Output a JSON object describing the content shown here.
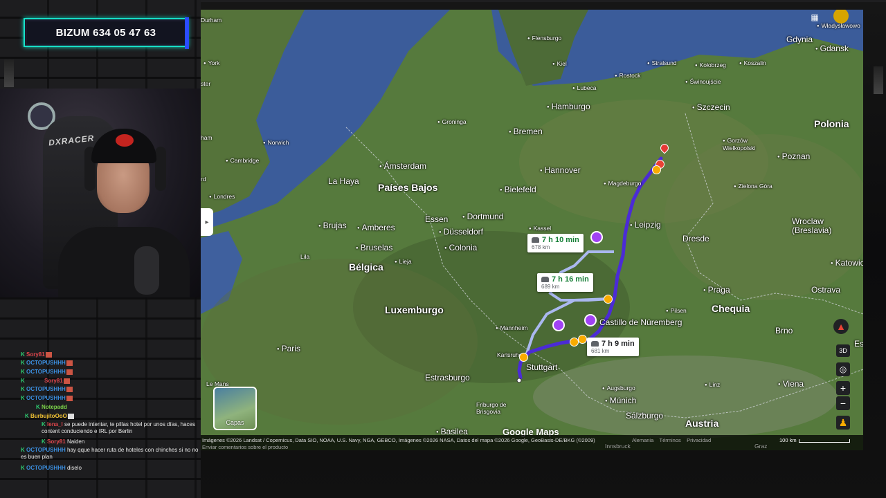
{
  "banner": {
    "text": "BIZUM 634 05 47 63"
  },
  "webcam": {
    "chair_brand": "DXRACER"
  },
  "chat": [
    {
      "user": "Sory81",
      "color": "#e0464c",
      "msg": ""
    },
    {
      "user": "OCTOPUSHHH",
      "color": "#3b8fe0",
      "msg": ""
    },
    {
      "user": "OCTOPUSHHH",
      "color": "#3b8fe0",
      "msg": ""
    },
    {
      "user": "Sory81",
      "color": "#e0464c",
      "msg": ""
    },
    {
      "user": "OCTOPUSHHH",
      "color": "#3b8fe0",
      "msg": ""
    },
    {
      "user": "OCTOPUSHHH",
      "color": "#3b8fe0",
      "msg": ""
    },
    {
      "user": "Notepadd",
      "color": "#7cd34a",
      "msg": ""
    },
    {
      "user": "BurbujitoOoO",
      "color": "#f1c232",
      "msg": ""
    },
    {
      "user": "lena_l",
      "color": "#e0464c",
      "msg": "se puede intentar, te pillas hotel por unos días, haces content conduciendo e IRL por Berlin"
    },
    {
      "user": "Sory81",
      "color": "#e0464c",
      "msg": "Naiden"
    },
    {
      "user": "OCTOPUSHHH",
      "color": "#3b8fe0",
      "msg": "hay qque hacer ruta de hoteles con chinches si no no es buen plan"
    },
    {
      "user": "OCTOPUSHHH",
      "color": "#3b8fe0",
      "msg": "diselo"
    }
  ],
  "map": {
    "labels": {
      "durham": "Durham",
      "york": "York",
      "ster": "ster",
      "ham": "ham",
      "rd": "rd",
      "cambridge": "Cambridge",
      "norwich": "Norwich",
      "londres": "Londres",
      "flensburgo": "Flensburgo",
      "kiel": "Kiel",
      "rostock": "Rostock",
      "stralsund": "Stralsund",
      "lubeca": "Lubeca",
      "hamburgo": "Hamburgo",
      "groninga": "Groninga",
      "bremen": "Bremen",
      "amsterdam": "Ámsterdam",
      "la_haya": "La Haya",
      "paises_bajos": "Países Bajos",
      "hannover": "Hannover",
      "magdeburgo": "Magdeburgo",
      "bielefeld": "Bielefeld",
      "essen": "Essen",
      "dortmund": "Dortmund",
      "dusseldorf": "Düsseldorf",
      "brujas": "Brujas",
      "amberes": "Amberes",
      "bruselas": "Bruselas",
      "colonia": "Colonia",
      "kassel": "Kassel",
      "leipzig": "Leipzig",
      "dresde": "Dresde",
      "belgica": "Bélgica",
      "lila": "Lila",
      "lieja": "Lieja",
      "luxemburgo": "Luxemburgo",
      "paris": "Paris",
      "mannheim": "Mannheim",
      "karlsruhe": "Karlsruhe",
      "stuttgart": "Stuttgart",
      "estrasburgo": "Estrasburgo",
      "le_mans": "Le Mans",
      "friburgo": "Friburgo de Brisgovia",
      "basilea": "Basilea",
      "augsburgo": "Augsburgo",
      "munich": "Múnich",
      "salzburgo": "Salzburgo",
      "austria": "Austria",
      "linz": "Linz",
      "viena": "Viena",
      "brno": "Brno",
      "chequia": "Chequia",
      "praga": "Praga",
      "pilsen": "Pilsen",
      "castillo": "Castillo de Núremberg",
      "polonia": "Polonia",
      "poznan": "Poznan",
      "szczecin": "Szczecin",
      "gdynia": "Gdynia",
      "gdansk": "Gdansk",
      "koszalin": "Koszalin",
      "kolobrzeg": "Kołobrzeg",
      "swinoujscie": "Świnoujście",
      "wladyslawowo": "Władysławowo",
      "gorzow": "Gorzów Wielkopolski",
      "zielona": "Zielona Góra",
      "wroclaw": "Wroclaw (Breslavia)",
      "katowice": "Katowice",
      "ostrava": "Ostrava",
      "es": "Es",
      "graz": "Graz",
      "innsbruck": "Innsbruck"
    },
    "routes": [
      {
        "time": "7 h 10 min",
        "distance": "678 km"
      },
      {
        "time": "7 h 16 min",
        "distance": "689 km"
      },
      {
        "time": "7 h 9 min",
        "distance": "681 km"
      }
    ],
    "layers_label": "Capas",
    "controls": {
      "compass": "compass-icon",
      "threed": "3D",
      "locate": "locate-icon",
      "zoom_in": "+",
      "zoom_out": "−",
      "pegman": "pegman-icon"
    },
    "google_maps": "Google Maps",
    "attribution": "Imágenes ©2026 Landsat / Copernicus, Data SIO, NOAA, U.S. Navy, NGA, GEBCO, Imágenes ©2026 NASA, Datos del mapa ©2026 Google, GeoBasis-DE/BKG (©2009)",
    "links": [
      "Alemania",
      "Términos",
      "Privacidad"
    ],
    "scale": "100 km",
    "feedback": "Enviar comentarios sobre el producto",
    "colors": {
      "route_main": "#4b2bd6",
      "route_alt": "#aab8f0"
    }
  }
}
